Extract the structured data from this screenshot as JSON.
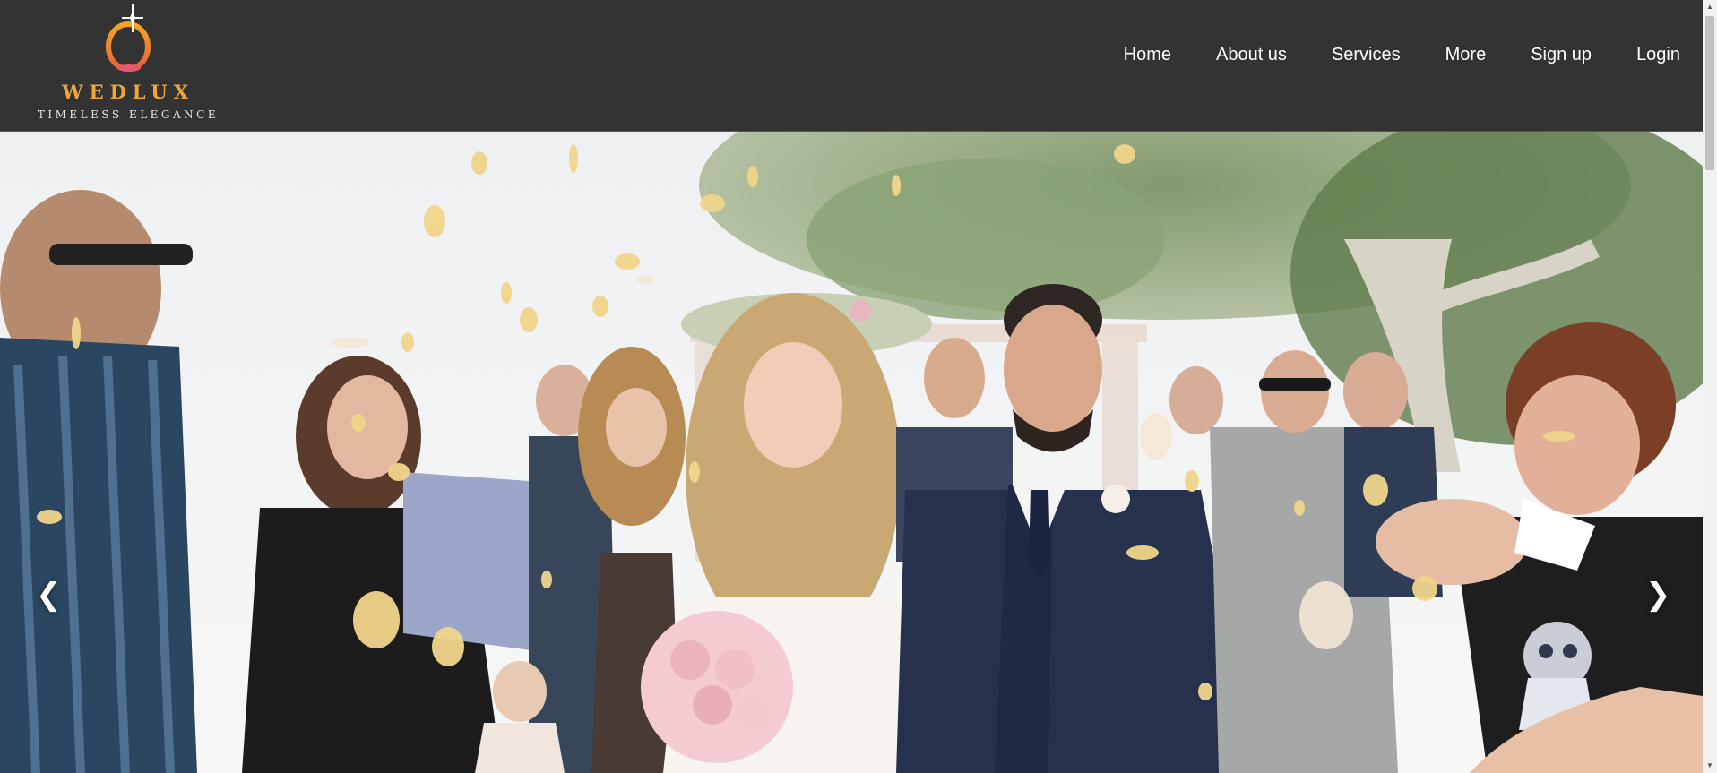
{
  "brand": {
    "name": "WEDLUX",
    "tagline": "TIMELESS ELEGANCE",
    "logo_icon": "ring-sparkle-icon"
  },
  "nav": {
    "items": [
      {
        "label": "Home"
      },
      {
        "label": "About us"
      },
      {
        "label": "Services"
      },
      {
        "label": "More"
      },
      {
        "label": "Sign up"
      },
      {
        "label": "Login"
      }
    ]
  },
  "hero": {
    "image": "wedding-couple-confetti-photo",
    "prev_icon": "chevron-left-icon",
    "prev_glyph": "❮",
    "next_icon": "chevron-right-icon",
    "next_glyph": "❯"
  },
  "scrollbar": {
    "up_glyph": "▲",
    "down_glyph": "▼"
  },
  "colors": {
    "header_bg": "#333333",
    "brand_orange": "#f0a63c",
    "nav_text": "#ffffff"
  }
}
